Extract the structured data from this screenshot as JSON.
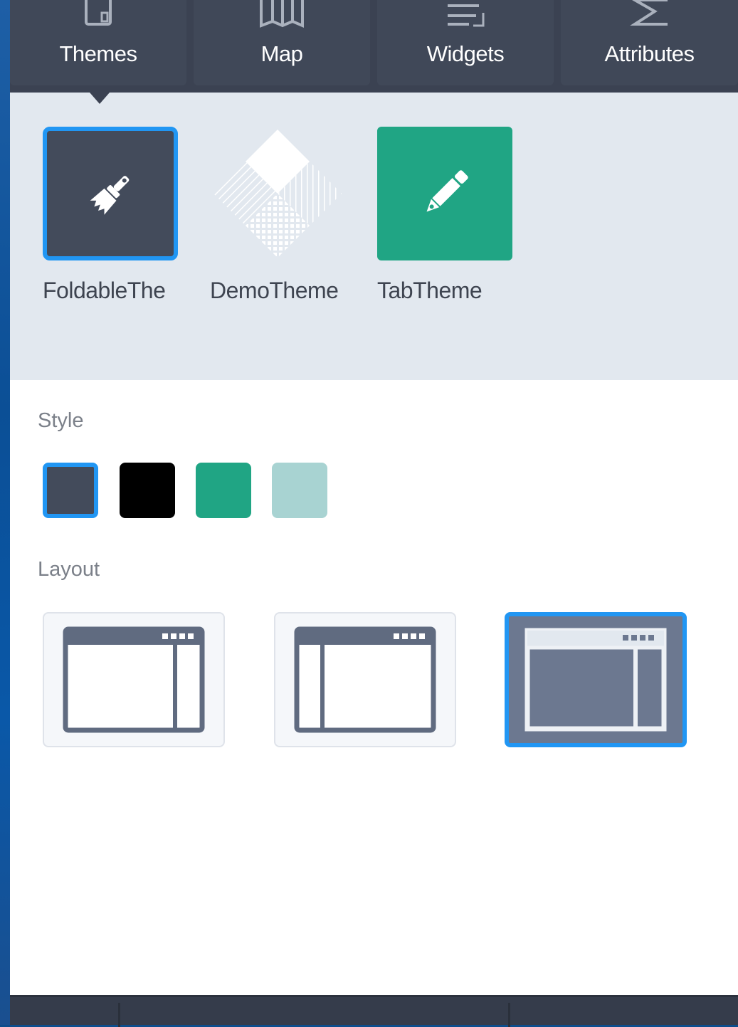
{
  "tabs": [
    {
      "label": "Themes",
      "icon": "themes-icon"
    },
    {
      "label": "Map",
      "icon": "map-icon"
    },
    {
      "label": "Widgets",
      "icon": "widgets-icon"
    },
    {
      "label": "Attributes",
      "icon": "attributes-icon"
    }
  ],
  "active_tab": "Themes",
  "themes": [
    {
      "name": "FoldableThe",
      "icon": "brush-icon",
      "selected": true
    },
    {
      "name": "DemoTheme",
      "icon": "demo-theme-diamond-icon",
      "selected": false
    },
    {
      "name": "TabTheme",
      "icon": "pencil-icon",
      "selected": false
    }
  ],
  "style": {
    "label": "Style",
    "swatches": [
      {
        "color": "#434b5b",
        "selected": true
      },
      {
        "color": "#000000",
        "selected": false
      },
      {
        "color": "#20a584",
        "selected": false
      },
      {
        "color": "#a8d3d2",
        "selected": false
      }
    ]
  },
  "layout": {
    "label": "Layout",
    "options": [
      {
        "icon": "layout-right-panel-icon",
        "selected": false
      },
      {
        "icon": "layout-left-panel-icon",
        "selected": false
      },
      {
        "icon": "layout-overlay-panel-icon",
        "selected": true
      }
    ]
  },
  "colors": {
    "accent": "#2196f3",
    "header_bg": "#3b4252",
    "theme_area_bg": "#e2e8ef"
  }
}
